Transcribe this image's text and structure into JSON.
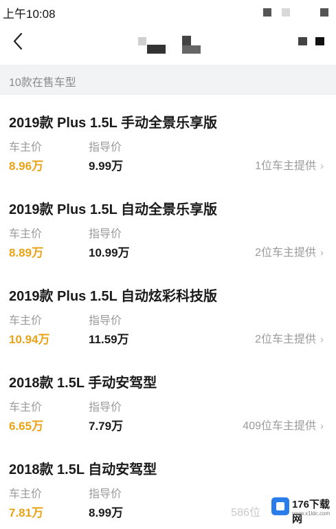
{
  "status_bar": {
    "time": "上午10:08"
  },
  "count_bar": {
    "text": "10款在售车型"
  },
  "labels": {
    "owner_price": "车主价",
    "guide_price": "指导价"
  },
  "models": [
    {
      "name": "2019款 Plus 1.5L 手动全景乐享版",
      "owner_price": "8.96万",
      "guide_price": "9.99万",
      "provider": "1位车主提供"
    },
    {
      "name": "2019款 Plus 1.5L 自动全景乐享版",
      "owner_price": "8.89万",
      "guide_price": "10.99万",
      "provider": "2位车主提供"
    },
    {
      "name": "2019款 Plus 1.5L 自动炫彩科技版",
      "owner_price": "10.94万",
      "guide_price": "11.59万",
      "provider": "2位车主提供"
    },
    {
      "name": "2018款 1.5L 手动安驾型",
      "owner_price": "6.65万",
      "guide_price": "7.79万",
      "provider": "409位车主提供"
    },
    {
      "name": "2018款 1.5L 自动安驾型",
      "owner_price": "7.81万",
      "guide_price": "8.99万",
      "provider": "586位"
    }
  ],
  "watermark": {
    "title": "176下载网",
    "subtitle": "www.x1ldc.com"
  },
  "colors": {
    "owner_price": "#e8a317",
    "count_bar_bg": "#f2f3f5",
    "label": "#9a9a9a"
  },
  "icons": {
    "back": "chevron-left-icon",
    "row_arrow": "chevron-right-icon"
  }
}
